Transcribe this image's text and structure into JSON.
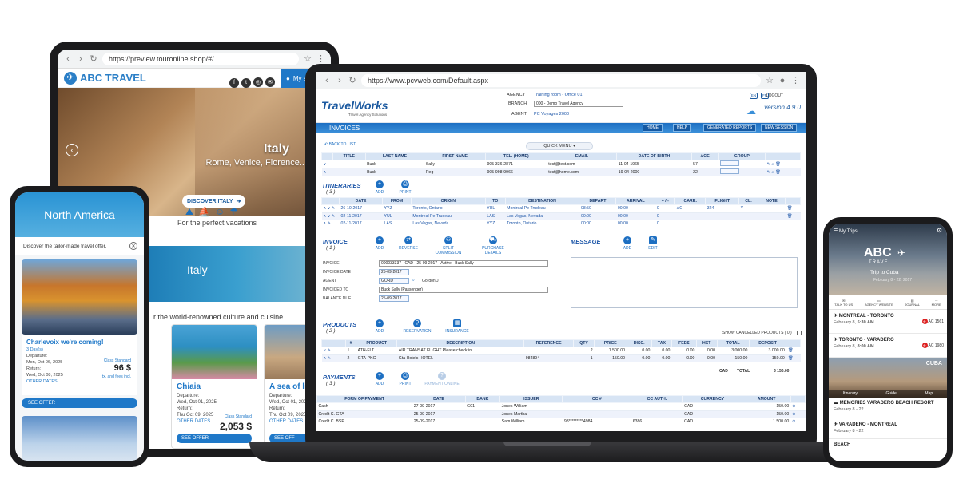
{
  "tablet": {
    "url": "https://preview.touronline.shop/#/",
    "brand": "ABC TRAVEL",
    "my_account": "My ac",
    "hero_title": "Italy",
    "hero_sub": "Rome, Venice, Florence...",
    "hero_button": "DISCOVER ITALY",
    "perfect_vacations": "For the perfect vacations",
    "italy_band": "Italy",
    "world_text": "r the world-renowned culture and cuisine.",
    "cards": [
      {
        "title": "Chiaia",
        "departure_label": "Departure:",
        "departure": "Wed, Oct 01, 2025",
        "return_label": "Return:",
        "return": "Thu Oct 09, 2025",
        "class": "Class Standard",
        "price": "2,053 $",
        "other_dates": "OTHER DATES",
        "see": "SEE OFFER"
      },
      {
        "title": "A sea of light",
        "departure_label": "Departure:",
        "departure": "Wed, Oct 01, 2025",
        "return_label": "Return:",
        "return": "Thu Oct 09, 2025",
        "other_dates": "OTHER DATES",
        "see": "SEE OFF"
      }
    ]
  },
  "phone_left": {
    "region": "North America",
    "discover": "Discover the tailor-made travel offer.",
    "card_title": "Charlevoix we're coming!",
    "days": "3 Day(s)",
    "departure_label": "Departure:",
    "departure": "Mon, Oct 06, 2025",
    "return_label": "Return:",
    "return": "Wed, Oct 08, 2025",
    "class": "Class Standard",
    "price": "96 $",
    "tax": "tx. and fees incl.",
    "other_dates": "OTHER DATES",
    "see": "SEE OFFER"
  },
  "laptop": {
    "url": "https://www.pcvweb.com/Default.aspx",
    "logo": "TravelWorks",
    "logo_sub": "Travel Agency Solutions",
    "agency_label": "AGENCY",
    "agency_value": "Training room - Office 01",
    "branch_label": "BRANCH",
    "branch_value": "000 - Demo Travel Agency",
    "agent_label": "AGENT",
    "agent_value": "PC Voyages 2000",
    "logout": "LOGOUT",
    "lang_fr": "FR",
    "lang_en": "EN",
    "version": "version 4.9.0",
    "section_title": "INVOICES",
    "top_buttons": [
      "HOME",
      "HELP",
      "GENERATED REPORTS",
      "NEW SESSION"
    ],
    "back_to_list": "BACK TO LIST",
    "quick_menu": "QUICK MENU",
    "passengers": {
      "headers": [
        "TITLE",
        "LAST NAME",
        "FIRST NAME",
        "TEL. (HOME)",
        "EMAIL",
        "DATE OF BIRTH",
        "AGE",
        "GROUP"
      ],
      "rows": [
        [
          "",
          "Buck",
          "Sally",
          "905-336-2871",
          "test@test.com",
          "11-04-1965",
          "57",
          ""
        ],
        [
          "",
          "Buck",
          "Reg",
          "905-998-9966",
          "test@home.com",
          "19-04-2000",
          "22",
          ""
        ]
      ]
    },
    "itineraries": {
      "title": "ITINERARIES",
      "count": "( 3 )",
      "add": "ADD",
      "print": "PRINT",
      "headers": [
        "DATE",
        "FROM",
        "ORIGIN",
        "TO",
        "DESTINATION",
        "DEPART",
        "ARRIVAL",
        "+ / -",
        "CARR.",
        "FLIGHT",
        "CL.",
        "NOTE"
      ],
      "rows": [
        [
          "26-10-2017",
          "YYZ",
          "Toronto, Ontario",
          "YUL",
          "Montreal Pe Trudeau",
          "08:50",
          "00:00",
          "0",
          "AC",
          "324",
          "Y",
          ""
        ],
        [
          "02-11-2017",
          "YUL",
          "Montreal Pe Trudeau",
          "LAS",
          "Las Vegas, Nevada",
          "00:00",
          "00:00",
          "0",
          "",
          "",
          "",
          ""
        ],
        [
          "02-11-2017",
          "LAS",
          "Las Vegas, Nevada",
          "YYZ",
          "Toronto, Ontario",
          "00:00",
          "00:00",
          "0",
          "",
          "",
          "",
          ""
        ]
      ]
    },
    "invoice": {
      "title": "INVOICE",
      "count": "( 1 )",
      "actions": [
        "ADD",
        "REVERSE",
        "SPLIT COMMISSION",
        "PURCHASE DETAILS"
      ],
      "fields": [
        {
          "label": "INVOICE",
          "value": "000033337 - CAD - 25-09-2017 - Active - Buck Sally"
        },
        {
          "label": "INVOICE DATE",
          "value": "25-09-2017"
        },
        {
          "label": "AGENT",
          "value": "GORD",
          "extra": "Gordon J"
        },
        {
          "label": "INVOICED TO",
          "value": "Buck Sally (Passenger)"
        },
        {
          "label": "BALANCE DUE",
          "value": "25-09-2017"
        }
      ]
    },
    "message": {
      "title": "MESSAGE",
      "add": "ADD",
      "edit": "EDIT"
    },
    "products": {
      "title": "PRODUCTS",
      "count": "( 2 )",
      "actions": [
        "ADD",
        "RESERVATION",
        "INSURANCE"
      ],
      "show_cancelled": "SHOW CANCELLED PRODUCTS ( 0 )",
      "headers": [
        "#",
        "PRODUCT",
        "DESCRIPTION",
        "REFERENCE",
        "QTY",
        "PRICE",
        "DISC.",
        "TAX",
        "FEES",
        "HST",
        "TOTAL",
        "DEPOSIT"
      ],
      "rows": [
        [
          "1",
          "ATH-FLT",
          "AIR TRANSAT FLIGHT Please check in",
          "",
          "2",
          "1 500.00",
          "0.00",
          "0.00",
          "0.00",
          "0.00",
          "3 000.00",
          "3 000.00"
        ],
        [
          "2",
          "GTA-PKG",
          "Gta Hotels HOTEL",
          "984894",
          "1",
          "150.00",
          "0.00",
          "0.00",
          "0.00",
          "0.00",
          "150.00",
          "150.00"
        ]
      ],
      "currency": "CAD",
      "total_label": "TOTAL",
      "total": "3 150.00"
    },
    "payments": {
      "title": "PAYMENTS",
      "count": "( 3 )",
      "actions": [
        "ADD",
        "PRINT",
        "PAYMENT ONLINE"
      ],
      "headers": [
        "FORM OF PAYMENT",
        "DATE",
        "BANK",
        "ISSUER",
        "CC #",
        "CC AUTH.",
        "CURRENCY",
        "AMOUNT"
      ],
      "rows": [
        [
          "Cash",
          "27-09-2017",
          "G01",
          "Jones William",
          "",
          "",
          "CAD",
          "150.00"
        ],
        [
          "Credit C. GTA",
          "25-09-2017",
          "",
          "Jones Martha",
          "",
          "",
          "CAD",
          "150.00"
        ],
        [
          "Credit C. BSP",
          "25-09-2017",
          "",
          "Sam William",
          "98*********4984",
          "6386",
          "CAD",
          "1 500.00"
        ]
      ]
    }
  },
  "phone_right": {
    "my_trips": "My Trips",
    "brand": "ABC",
    "brand_sub": "TRAVEL",
    "trip": "Trip to Cuba",
    "trip_dates": "February 8 - 22, 2017",
    "nav": [
      "TALK TO US",
      "AGENCY WEBSITE",
      "JOURNAL",
      "MORE"
    ],
    "flights": [
      {
        "route": "MONTREAL - TORONTO",
        "date": "February 8,",
        "time": "5:30 AM",
        "code": "AC 1561"
      },
      {
        "route": "TORONTO - VARADERO",
        "date": "February 8,",
        "time": "8:00 AM",
        "code": "AC 1980"
      },
      {
        "route": "MEMORIES VARADERO BEACH RESORT",
        "date": "February 8 - 22",
        "time": "",
        "code": ""
      },
      {
        "route": "VARADERO - MONTREAL",
        "date": "February 8 - 22",
        "time": "",
        "code": ""
      }
    ],
    "cuba_label": "CUBA",
    "tabs": [
      "Itinerary",
      "Guide",
      "Map"
    ],
    "bottom": "BEACH"
  },
  "colors": {
    "accent": "#1f78c8",
    "brand_dark": "#1c5aa0",
    "table_header": "#d7e4f4"
  }
}
